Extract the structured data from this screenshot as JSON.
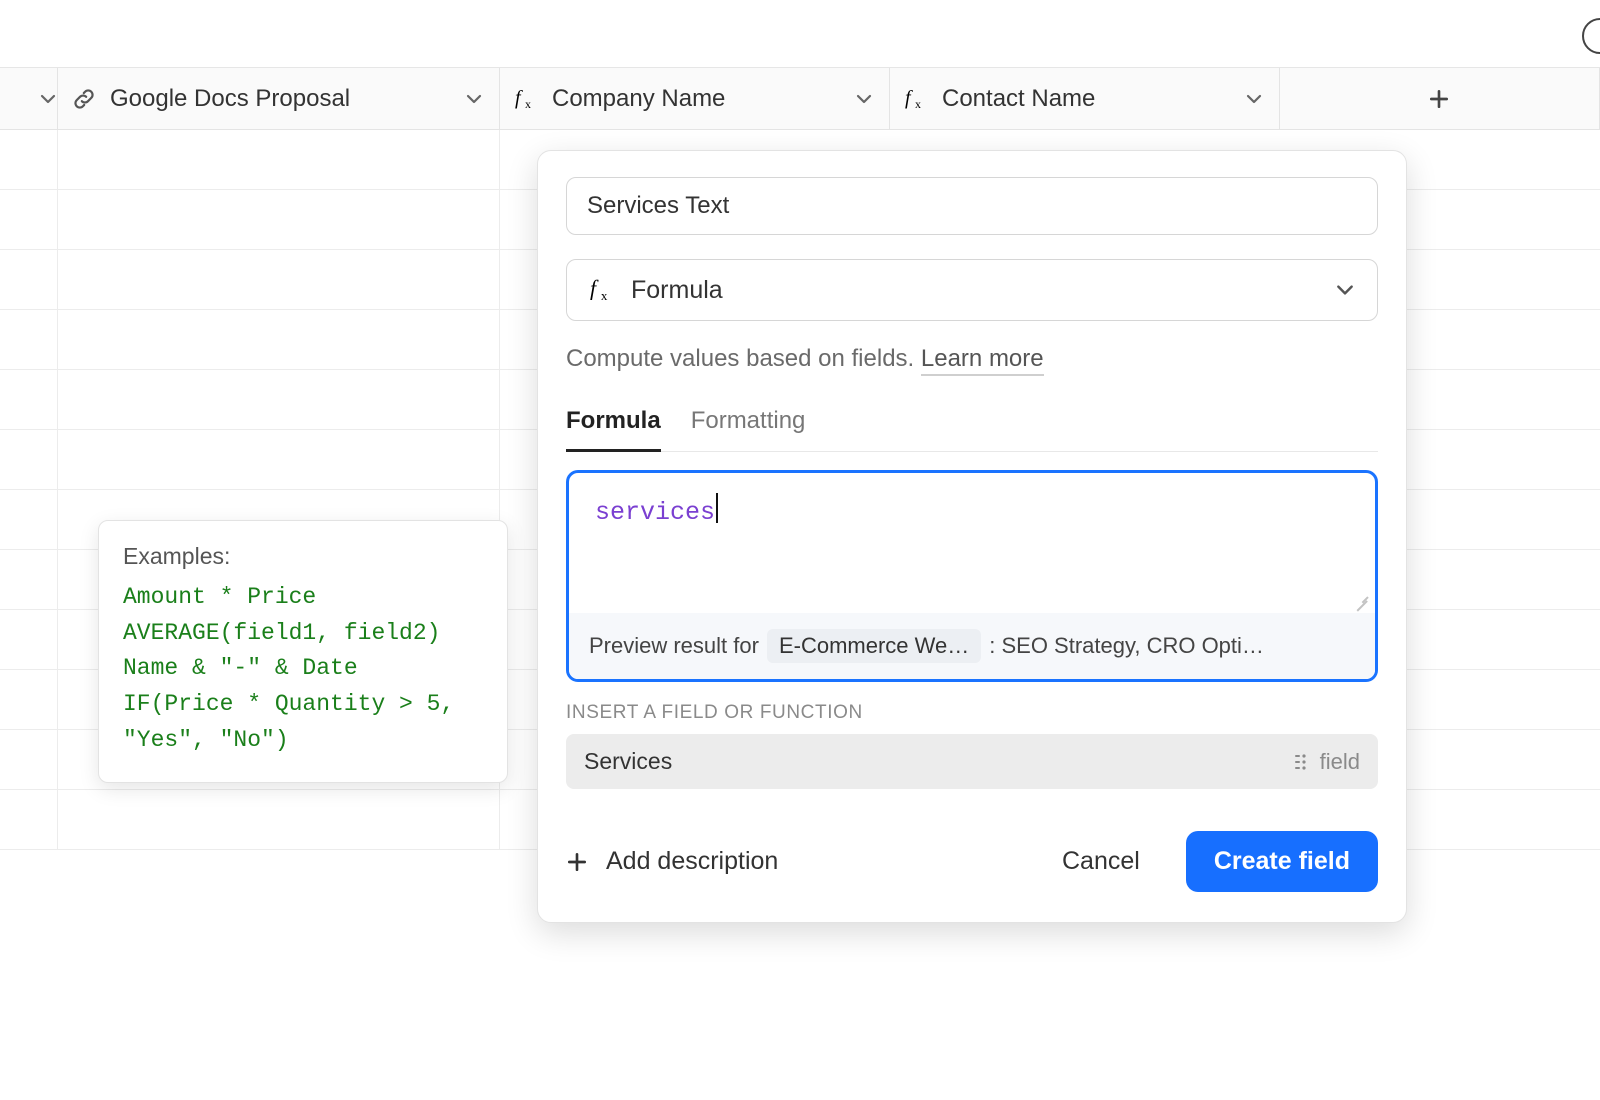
{
  "columns": {
    "col1": {
      "label": "Google Docs Proposal",
      "icon": "link-icon"
    },
    "col2": {
      "label": "Company Name",
      "icon": "formula-icon"
    },
    "col3": {
      "label": "Contact Name",
      "icon": "formula-icon"
    }
  },
  "examples": {
    "title": "Examples:",
    "lines": "Amount * Price\nAVERAGE(field1, field2)\nName & \"-\" & Date\nIF(Price * Quantity > 5, \"Yes\", \"No\")"
  },
  "popover": {
    "field_name": "Services Text",
    "type_label": "Formula",
    "helper_text": "Compute values based on fields. ",
    "learn_more": "Learn more",
    "tabs": {
      "formula": "Formula",
      "formatting": "Formatting"
    },
    "formula_text": "services",
    "preview": {
      "prefix": "Preview result for",
      "record": "E-Commerce We…",
      "result": ": SEO Strategy, CRO Opti…"
    },
    "insert_label": "INSERT A FIELD OR FUNCTION",
    "suggestion": {
      "name": "Services",
      "kind": "field"
    },
    "add_description": "Add description",
    "cancel": "Cancel",
    "create": "Create field"
  }
}
